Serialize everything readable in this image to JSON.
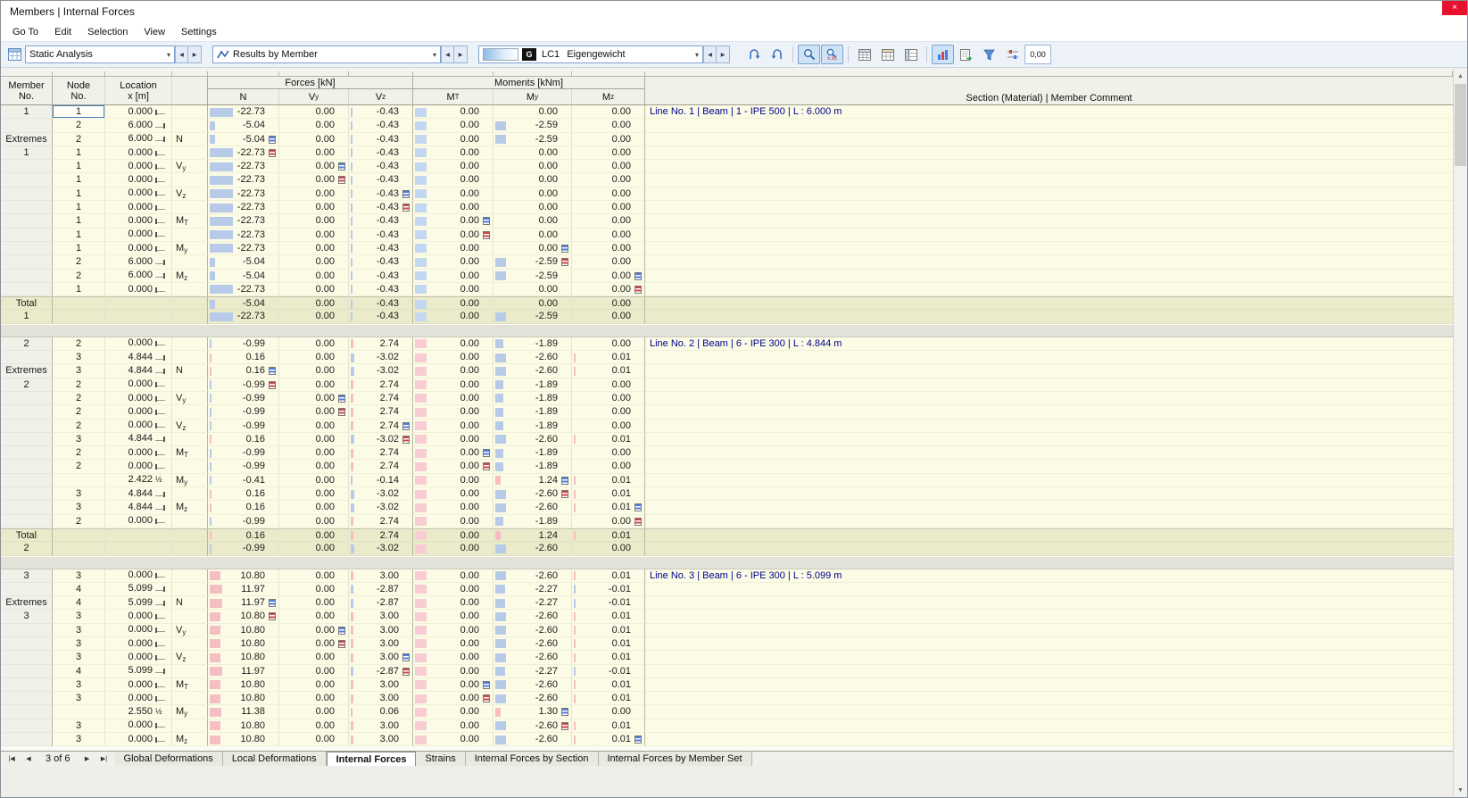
{
  "window": {
    "title": "Members | Internal Forces",
    "close_icon": "×"
  },
  "menu": {
    "items": [
      "Go To",
      "Edit",
      "Selection",
      "View",
      "Settings"
    ]
  },
  "toolbar": {
    "analysis_type": "Static Analysis",
    "results_mode": "Results by Member",
    "load_type_badge": "G",
    "load_case": "LC1",
    "load_case_name": "Eigengewicht",
    "decimal_places_label": "0,00",
    "values_icon_label": "x.xx",
    "prev_icon": "◀",
    "next_icon": "▶",
    "chevron_icon": "▾",
    "scroll_up_icon": "▲",
    "scroll_down_icon": "▼"
  },
  "colors": {
    "bar_negative_blue": "#b7cbe9",
    "bar_positive_pink": "#f5bec3",
    "mt_zero_blue": "#c3d7f0",
    "mt_zero_pink": "#f7ccd2",
    "row_bg": "#fcfce6",
    "total_bg": "#ebebcb",
    "header_bg": "#f1f1ea",
    "comment_text": "#00008b",
    "max_marker": "#4a7de0",
    "min_marker": "#d04545",
    "active_tool_bg": "#cfe3f8"
  },
  "table": {
    "headers": {
      "member": [
        "Member",
        "No."
      ],
      "node": [
        "Node",
        "No."
      ],
      "location": [
        "Location",
        "x [m]"
      ],
      "forces_group": "Forces [kN]",
      "moments_group": "Moments [kNm]",
      "columns": [
        "N",
        "Vy",
        "Vz",
        "MT",
        "My",
        "Mz"
      ],
      "comment": "Section (Material) | Member Comment"
    },
    "loc_half": "½",
    "groups": [
      {
        "id": "1",
        "mt_zero": "blue",
        "rows": [
          {
            "m": "1",
            "n": "1",
            "x": "0.000",
            "sfx": "s",
            "v": [
              "-22.73",
              "0.00",
              "-0.43",
              "0.00",
              "0.00",
              "0.00"
            ],
            "sel": true,
            "cm": "Line No. 1 | Beam | 1 - IPE 500 | L : 6.000 m"
          },
          {
            "n": "2",
            "x": "6.000",
            "sfx": "e",
            "v": [
              "-5.04",
              "0.00",
              "-0.43",
              "0.00",
              "-2.59",
              "0.00"
            ]
          },
          {
            "m": "Extremes",
            "n": "2",
            "x": "6.000",
            "sfx": "e",
            "e": "N",
            "v": [
              "-5.04",
              "0.00",
              "-0.43",
              "0.00",
              "-2.59",
              "0.00"
            ],
            "ic": 0,
            "it": "max"
          },
          {
            "m": "1",
            "n": "1",
            "x": "0.000",
            "sfx": "s",
            "v": [
              "-22.73",
              "0.00",
              "-0.43",
              "0.00",
              "0.00",
              "0.00"
            ],
            "ic": 0,
            "it": "min"
          },
          {
            "n": "1",
            "x": "0.000",
            "sfx": "s",
            "e": "Vy",
            "v": [
              "-22.73",
              "0.00",
              "-0.43",
              "0.00",
              "0.00",
              "0.00"
            ],
            "ic": 1,
            "it": "max"
          },
          {
            "n": "1",
            "x": "0.000",
            "sfx": "s",
            "v": [
              "-22.73",
              "0.00",
              "-0.43",
              "0.00",
              "0.00",
              "0.00"
            ],
            "ic": 1,
            "it": "min"
          },
          {
            "n": "1",
            "x": "0.000",
            "sfx": "s",
            "e": "Vz",
            "v": [
              "-22.73",
              "0.00",
              "-0.43",
              "0.00",
              "0.00",
              "0.00"
            ],
            "ic": 2,
            "it": "max"
          },
          {
            "n": "1",
            "x": "0.000",
            "sfx": "s",
            "v": [
              "-22.73",
              "0.00",
              "-0.43",
              "0.00",
              "0.00",
              "0.00"
            ],
            "ic": 2,
            "it": "min"
          },
          {
            "n": "1",
            "x": "0.000",
            "sfx": "s",
            "e": "MT",
            "v": [
              "-22.73",
              "0.00",
              "-0.43",
              "0.00",
              "0.00",
              "0.00"
            ],
            "ic": 3,
            "it": "max"
          },
          {
            "n": "1",
            "x": "0.000",
            "sfx": "s",
            "v": [
              "-22.73",
              "0.00",
              "-0.43",
              "0.00",
              "0.00",
              "0.00"
            ],
            "ic": 3,
            "it": "min"
          },
          {
            "n": "1",
            "x": "0.000",
            "sfx": "s",
            "e": "My",
            "v": [
              "-22.73",
              "0.00",
              "-0.43",
              "0.00",
              "0.00",
              "0.00"
            ],
            "ic": 4,
            "it": "max"
          },
          {
            "n": "2",
            "x": "6.000",
            "sfx": "e",
            "v": [
              "-5.04",
              "0.00",
              "-0.43",
              "0.00",
              "-2.59",
              "0.00"
            ],
            "ic": 4,
            "it": "min"
          },
          {
            "n": "2",
            "x": "6.000",
            "sfx": "e",
            "e": "Mz",
            "v": [
              "-5.04",
              "0.00",
              "-0.43",
              "0.00",
              "-2.59",
              "0.00"
            ],
            "ic": 5,
            "it": "max"
          },
          {
            "n": "1",
            "x": "0.000",
            "sfx": "s",
            "v": [
              "-22.73",
              "0.00",
              "-0.43",
              "0.00",
              "0.00",
              "0.00"
            ],
            "ic": 5,
            "it": "min"
          },
          {
            "tt": "t",
            "m": "Total",
            "v": [
              "-5.04",
              "0.00",
              "-0.43",
              "0.00",
              "0.00",
              "0.00"
            ]
          },
          {
            "tt": "t",
            "m": "1",
            "v": [
              "-22.73",
              "0.00",
              "-0.43",
              "0.00",
              "-2.59",
              "0.00"
            ]
          }
        ]
      },
      {
        "id": "2",
        "mt_zero": "pink",
        "rows": [
          {
            "m": "2",
            "n": "2",
            "x": "0.000",
            "sfx": "s",
            "v": [
              "-0.99",
              "0.00",
              "2.74",
              "0.00",
              "-1.89",
              "0.00"
            ],
            "cm": "Line No. 2 | Beam | 6 - IPE 300 | L : 4.844 m"
          },
          {
            "n": "3",
            "x": "4.844",
            "sfx": "e",
            "v": [
              "0.16",
              "0.00",
              "-3.02",
              "0.00",
              "-2.60",
              "0.01"
            ]
          },
          {
            "m": "Extremes",
            "n": "3",
            "x": "4.844",
            "sfx": "e",
            "e": "N",
            "v": [
              "0.16",
              "0.00",
              "-3.02",
              "0.00",
              "-2.60",
              "0.01"
            ],
            "ic": 0,
            "it": "max"
          },
          {
            "m": "2",
            "n": "2",
            "x": "0.000",
            "sfx": "s",
            "v": [
              "-0.99",
              "0.00",
              "2.74",
              "0.00",
              "-1.89",
              "0.00"
            ],
            "ic": 0,
            "it": "min"
          },
          {
            "n": "2",
            "x": "0.000",
            "sfx": "s",
            "e": "Vy",
            "v": [
              "-0.99",
              "0.00",
              "2.74",
              "0.00",
              "-1.89",
              "0.00"
            ],
            "ic": 1,
            "it": "max"
          },
          {
            "n": "2",
            "x": "0.000",
            "sfx": "s",
            "v": [
              "-0.99",
              "0.00",
              "2.74",
              "0.00",
              "-1.89",
              "0.00"
            ],
            "ic": 1,
            "it": "min"
          },
          {
            "n": "2",
            "x": "0.000",
            "sfx": "s",
            "e": "Vz",
            "v": [
              "-0.99",
              "0.00",
              "2.74",
              "0.00",
              "-1.89",
              "0.00"
            ],
            "ic": 2,
            "it": "max"
          },
          {
            "n": "3",
            "x": "4.844",
            "sfx": "e",
            "v": [
              "0.16",
              "0.00",
              "-3.02",
              "0.00",
              "-2.60",
              "0.01"
            ],
            "ic": 2,
            "it": "min"
          },
          {
            "n": "2",
            "x": "0.000",
            "sfx": "s",
            "e": "MT",
            "v": [
              "-0.99",
              "0.00",
              "2.74",
              "0.00",
              "-1.89",
              "0.00"
            ],
            "ic": 3,
            "it": "max"
          },
          {
            "n": "2",
            "x": "0.000",
            "sfx": "s",
            "v": [
              "-0.99",
              "0.00",
              "2.74",
              "0.00",
              "-1.89",
              "0.00"
            ],
            "ic": 3,
            "it": "min"
          },
          {
            "x": "2.422",
            "sfx": "h",
            "e": "My",
            "v": [
              "-0.41",
              "0.00",
              "-0.14",
              "0.00",
              "1.24",
              "0.01"
            ],
            "ic": 4,
            "it": "max"
          },
          {
            "n": "3",
            "x": "4.844",
            "sfx": "e",
            "v": [
              "0.16",
              "0.00",
              "-3.02",
              "0.00",
              "-2.60",
              "0.01"
            ],
            "ic": 4,
            "it": "min"
          },
          {
            "n": "3",
            "x": "4.844",
            "sfx": "e",
            "e": "Mz",
            "v": [
              "0.16",
              "0.00",
              "-3.02",
              "0.00",
              "-2.60",
              "0.01"
            ],
            "ic": 5,
            "it": "max"
          },
          {
            "n": "2",
            "x": "0.000",
            "sfx": "s",
            "v": [
              "-0.99",
              "0.00",
              "2.74",
              "0.00",
              "-1.89",
              "0.00"
            ],
            "ic": 5,
            "it": "min"
          },
          {
            "tt": "t",
            "m": "Total",
            "v": [
              "0.16",
              "0.00",
              "2.74",
              "0.00",
              "1.24",
              "0.01"
            ]
          },
          {
            "tt": "t",
            "m": "2",
            "v": [
              "-0.99",
              "0.00",
              "-3.02",
              "0.00",
              "-2.60",
              "0.00"
            ]
          }
        ]
      },
      {
        "id": "3",
        "mt_zero": "pink",
        "rows": [
          {
            "m": "3",
            "n": "3",
            "x": "0.000",
            "sfx": "s",
            "v": [
              "10.80",
              "0.00",
              "3.00",
              "0.00",
              "-2.60",
              "0.01"
            ],
            "cm": "Line No. 3 | Beam | 6 - IPE 300 | L : 5.099 m"
          },
          {
            "n": "4",
            "x": "5.099",
            "sfx": "e",
            "v": [
              "11.97",
              "0.00",
              "-2.87",
              "0.00",
              "-2.27",
              "-0.01"
            ]
          },
          {
            "m": "Extremes",
            "n": "4",
            "x": "5.099",
            "sfx": "e",
            "e": "N",
            "v": [
              "11.97",
              "0.00",
              "-2.87",
              "0.00",
              "-2.27",
              "-0.01"
            ],
            "ic": 0,
            "it": "max"
          },
          {
            "m": "3",
            "n": "3",
            "x": "0.000",
            "sfx": "s",
            "v": [
              "10.80",
              "0.00",
              "3.00",
              "0.00",
              "-2.60",
              "0.01"
            ],
            "ic": 0,
            "it": "min"
          },
          {
            "n": "3",
            "x": "0.000",
            "sfx": "s",
            "e": "Vy",
            "v": [
              "10.80",
              "0.00",
              "3.00",
              "0.00",
              "-2.60",
              "0.01"
            ],
            "ic": 1,
            "it": "max"
          },
          {
            "n": "3",
            "x": "0.000",
            "sfx": "s",
            "v": [
              "10.80",
              "0.00",
              "3.00",
              "0.00",
              "-2.60",
              "0.01"
            ],
            "ic": 1,
            "it": "min"
          },
          {
            "n": "3",
            "x": "0.000",
            "sfx": "s",
            "e": "Vz",
            "v": [
              "10.80",
              "0.00",
              "3.00",
              "0.00",
              "-2.60",
              "0.01"
            ],
            "ic": 2,
            "it": "max"
          },
          {
            "n": "4",
            "x": "5.099",
            "sfx": "e",
            "v": [
              "11.97",
              "0.00",
              "-2.87",
              "0.00",
              "-2.27",
              "-0.01"
            ],
            "ic": 2,
            "it": "min"
          },
          {
            "n": "3",
            "x": "0.000",
            "sfx": "s",
            "e": "MT",
            "v": [
              "10.80",
              "0.00",
              "3.00",
              "0.00",
              "-2.60",
              "0.01"
            ],
            "ic": 3,
            "it": "max"
          },
          {
            "n": "3",
            "x": "0.000",
            "sfx": "s",
            "v": [
              "10.80",
              "0.00",
              "3.00",
              "0.00",
              "-2.60",
              "0.01"
            ],
            "ic": 3,
            "it": "min"
          },
          {
            "x": "2.550",
            "sfx": "h",
            "e": "My",
            "v": [
              "11.38",
              "0.00",
              "0.06",
              "0.00",
              "1.30",
              "0.00"
            ],
            "ic": 4,
            "it": "max"
          },
          {
            "n": "3",
            "x": "0.000",
            "sfx": "s",
            "v": [
              "10.80",
              "0.00",
              "3.00",
              "0.00",
              "-2.60",
              "0.01"
            ],
            "ic": 4,
            "it": "min"
          },
          {
            "n": "3",
            "x": "0.000",
            "sfx": "s",
            "e": "Mz",
            "v": [
              "10.80",
              "0.00",
              "3.00",
              "0.00",
              "-2.60",
              "0.01"
            ],
            "ic": 5,
            "it": "max"
          }
        ]
      }
    ]
  },
  "footer": {
    "pager": "3 of 6",
    "nav_icons": [
      "|◀",
      "◀",
      "▶",
      "▶|"
    ],
    "tabs": [
      {
        "label": "Global Deformations",
        "active": false
      },
      {
        "label": "Local Deformations",
        "active": false
      },
      {
        "label": "Internal Forces",
        "active": true
      },
      {
        "label": "Strains",
        "active": false
      },
      {
        "label": "Internal Forces by Section",
        "active": false
      },
      {
        "label": "Internal Forces by Member Set",
        "active": false
      }
    ]
  }
}
